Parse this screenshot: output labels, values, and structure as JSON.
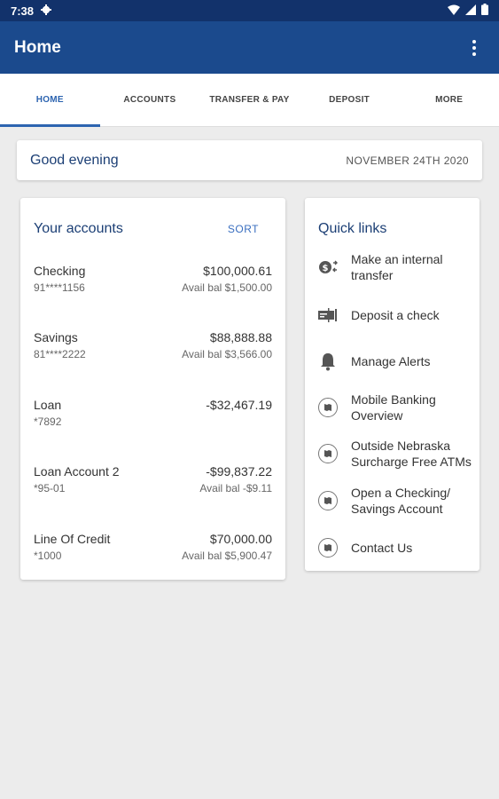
{
  "status": {
    "time": "7:38",
    "icons": [
      "gear-icon",
      "wifi-icon",
      "signal-icon",
      "battery-icon"
    ]
  },
  "appbar": {
    "title": "Home"
  },
  "tabs": [
    {
      "label": "HOME",
      "active": true
    },
    {
      "label": "ACCOUNTS"
    },
    {
      "label": "TRANSFER & PAY"
    },
    {
      "label": "DEPOSIT"
    },
    {
      "label": "MORE"
    }
  ],
  "greeting": {
    "text": "Good evening",
    "date": "NOVEMBER 24TH 2020"
  },
  "accounts": {
    "title": "Your accounts",
    "sort_label": "SORT",
    "items": [
      {
        "name": "Checking",
        "number": "91****1156",
        "balance": "$100,000.61",
        "avail": "Avail bal $1,500.00"
      },
      {
        "name": "Savings",
        "number": "81****2222",
        "balance": "$88,888.88",
        "avail": "Avail bal $3,566.00"
      },
      {
        "name": "Loan",
        "number": "*7892",
        "balance": "-$32,467.19",
        "avail": ""
      },
      {
        "name": "Loan Account 2",
        "number": "*95-01",
        "balance": "-$99,837.22",
        "avail": "Avail bal -$9.11"
      },
      {
        "name": "Line Of Credit",
        "number": "*1000",
        "balance": "$70,000.00",
        "avail": "Avail bal $5,900.47"
      }
    ]
  },
  "quick_links": {
    "title": "Quick links",
    "items": [
      {
        "line1": "Make an internal",
        "line2": "transfer",
        "icon": "transfer-money-icon"
      },
      {
        "line1": "Deposit a check",
        "line2": "",
        "icon": "check-deposit-icon"
      },
      {
        "line1": "Manage Alerts",
        "line2": "",
        "icon": "bell-icon"
      },
      {
        "line1": "Mobile Banking",
        "line2": "Overview",
        "icon": "map-link-icon"
      },
      {
        "line1": "Outside Nebraska",
        "line2": "Surcharge Free ATMs",
        "icon": "map-link-icon"
      },
      {
        "line1": "Open a Checking/",
        "line2": "Savings Account",
        "icon": "map-link-icon"
      },
      {
        "line1": "Contact Us",
        "line2": "",
        "icon": "map-link-icon"
      }
    ]
  },
  "colors": {
    "appbar": "#1b4a8d",
    "statusbar": "#12326b",
    "accent": "#2d64b0",
    "background": "#ececec"
  }
}
